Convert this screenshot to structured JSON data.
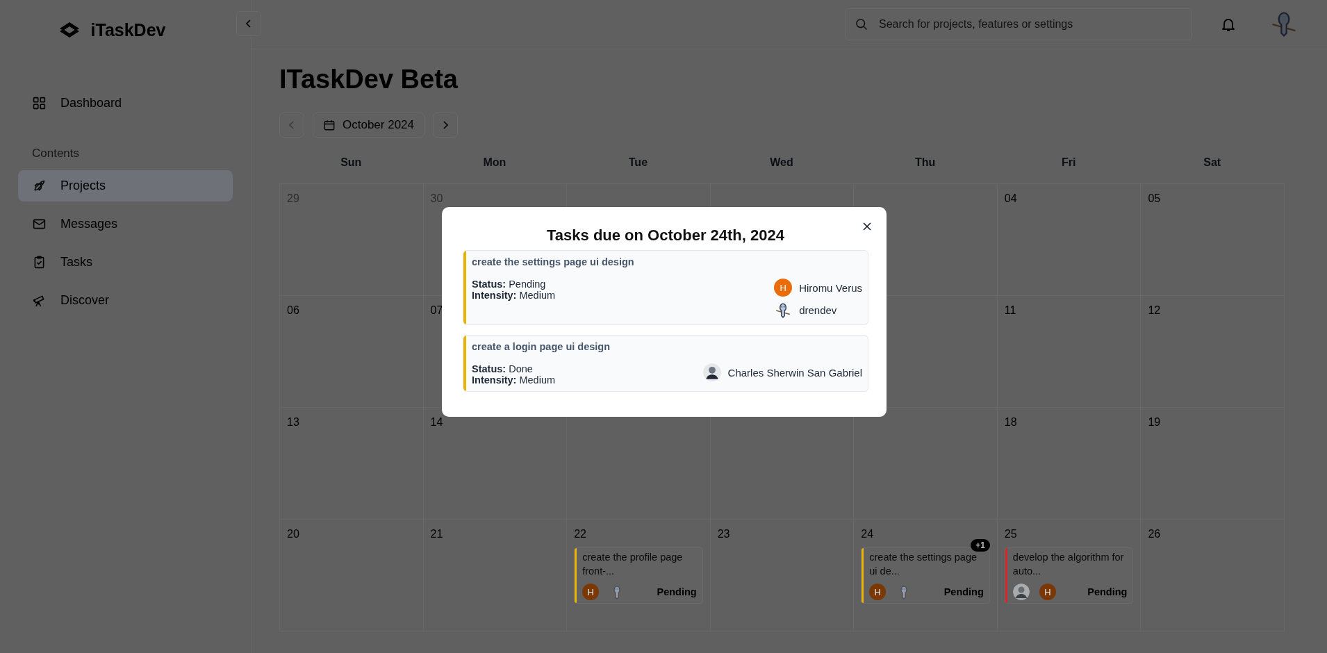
{
  "sidebar": {
    "logo": "iTaskDev",
    "groups": [
      {
        "items": [
          {
            "label": "Dashboard",
            "selected": false
          }
        ]
      },
      {
        "heading": "Contents",
        "items": [
          {
            "label": "Projects",
            "selected": true
          },
          {
            "label": "Messages",
            "selected": false
          },
          {
            "label": "Tasks",
            "selected": false
          },
          {
            "label": "Discover",
            "selected": false
          }
        ]
      }
    ]
  },
  "header": {
    "search": {
      "placeholder": "Search for projects, features or settings"
    }
  },
  "page": {
    "title": "ITaskDev Beta"
  },
  "month_nav": {
    "month": "October 2024",
    "prev_disabled": true,
    "next_disabled": false
  },
  "calendar": {
    "weekdays": [
      "Sun",
      "Mon",
      "Tue",
      "Wed",
      "Thu",
      "Fri",
      "Sat"
    ],
    "weeks": [
      {
        "before_dialog": [
          {
            "day": "29",
            "outside_month": true
          },
          {
            "day": "30",
            "outside_month": true
          }
        ],
        "after_dialog": [
          {
            "day": "04",
            "outside_month": false
          },
          {
            "day": "05",
            "outside_month": false
          }
        ]
      },
      {
        "before_dialog": [
          {
            "day": "06",
            "outside_month": false
          },
          {
            "day": "07",
            "outside_month": false
          }
        ],
        "after_dialog": [
          {
            "day": "11",
            "outside_month": false
          },
          {
            "day": "12",
            "outside_month": false
          }
        ]
      },
      {
        "before_dialog": [
          {
            "day": "13",
            "outside_month": false
          },
          {
            "day": "14",
            "outside_month": false
          }
        ],
        "after_dialog": [
          {
            "day": "18",
            "outside_month": false
          },
          {
            "day": "19",
            "outside_month": false
          }
        ]
      },
      {
        "days": [
          {
            "day": "20",
            "outside_month": false
          },
          {
            "day": "21",
            "outside_month": false
          },
          {
            "day": "22",
            "outside_month": false,
            "task": {
              "title": "create the profile page front-...",
              "color": "#eab308",
              "status": "Pending",
              "assignees": [
                {
                  "kind": "initial",
                  "initial": "H"
                },
                {
                  "kind": "figure"
                }
              ]
            }
          },
          {
            "day": "23",
            "outside_month": false
          },
          {
            "day": "24",
            "outside_month": false,
            "more": "+1",
            "task": {
              "title": "create the settings page ui de...",
              "color": "#eab308",
              "status": "Pending",
              "assignees": [
                {
                  "kind": "initial",
                  "initial": "H"
                },
                {
                  "kind": "figure"
                }
              ]
            }
          },
          {
            "day": "25",
            "outside_month": false,
            "task": {
              "title": "develop the algorithm for auto...",
              "color": "#dc2626",
              "status": "Pending",
              "assignees": [
                {
                  "kind": "photo"
                },
                {
                  "kind": "initial",
                  "initial": "H"
                }
              ]
            }
          },
          {
            "day": "26",
            "outside_month": false
          }
        ]
      }
    ]
  },
  "modal": {
    "title": "Tasks due on October 24th, 2024",
    "tasks": [
      {
        "title": "create the settings page ui design",
        "color": "#eab308",
        "status": "**Status:** Pending",
        "intensity": "**Intensity:** Medium",
        "assignees": [
          {
            "kind": "initial",
            "initial": "H",
            "name": "Hiromu Verus"
          },
          {
            "kind": "figure",
            "name": "drendev"
          }
        ]
      },
      {
        "title": "create a login page ui design",
        "color": "#eab308",
        "status": "**Status:** Done",
        "intensity": "**Intensity:** Medium",
        "assignees": [
          {
            "kind": "photo",
            "name": "Charles Sherwin San Gabriel"
          }
        ]
      }
    ]
  }
}
